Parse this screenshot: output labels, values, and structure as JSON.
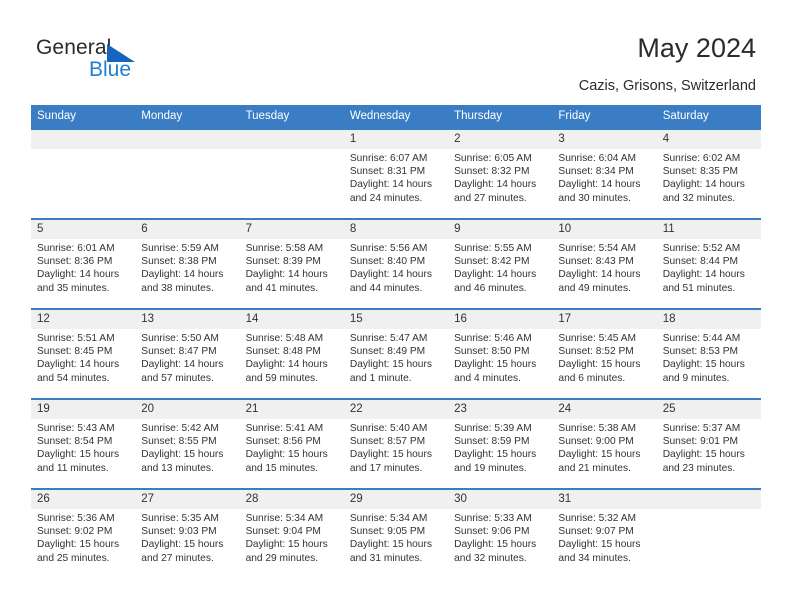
{
  "brand": {
    "name_top": "General",
    "name_bottom": "Blue",
    "triangle_color": "#1565c0",
    "blue_text_color": "#1b7fd4"
  },
  "header": {
    "title": "May 2024",
    "subtitle": "Cazis, Grisons, Switzerland"
  },
  "theme": {
    "header_blue": "#3b7dc4",
    "daynum_band": "#f0f0f0",
    "text": "#333333"
  },
  "calendar": {
    "weekday_headers": [
      "Sunday",
      "Monday",
      "Tuesday",
      "Wednesday",
      "Thursday",
      "Friday",
      "Saturday"
    ],
    "weeks": [
      [
        {
          "day": "",
          "sunrise": "",
          "sunset": "",
          "daylight_line1": "",
          "daylight_line2": ""
        },
        {
          "day": "",
          "sunrise": "",
          "sunset": "",
          "daylight_line1": "",
          "daylight_line2": ""
        },
        {
          "day": "",
          "sunrise": "",
          "sunset": "",
          "daylight_line1": "",
          "daylight_line2": ""
        },
        {
          "day": "1",
          "sunrise": "Sunrise: 6:07 AM",
          "sunset": "Sunset: 8:31 PM",
          "daylight_line1": "Daylight: 14 hours",
          "daylight_line2": "and 24 minutes."
        },
        {
          "day": "2",
          "sunrise": "Sunrise: 6:05 AM",
          "sunset": "Sunset: 8:32 PM",
          "daylight_line1": "Daylight: 14 hours",
          "daylight_line2": "and 27 minutes."
        },
        {
          "day": "3",
          "sunrise": "Sunrise: 6:04 AM",
          "sunset": "Sunset: 8:34 PM",
          "daylight_line1": "Daylight: 14 hours",
          "daylight_line2": "and 30 minutes."
        },
        {
          "day": "4",
          "sunrise": "Sunrise: 6:02 AM",
          "sunset": "Sunset: 8:35 PM",
          "daylight_line1": "Daylight: 14 hours",
          "daylight_line2": "and 32 minutes."
        }
      ],
      [
        {
          "day": "5",
          "sunrise": "Sunrise: 6:01 AM",
          "sunset": "Sunset: 8:36 PM",
          "daylight_line1": "Daylight: 14 hours",
          "daylight_line2": "and 35 minutes."
        },
        {
          "day": "6",
          "sunrise": "Sunrise: 5:59 AM",
          "sunset": "Sunset: 8:38 PM",
          "daylight_line1": "Daylight: 14 hours",
          "daylight_line2": "and 38 minutes."
        },
        {
          "day": "7",
          "sunrise": "Sunrise: 5:58 AM",
          "sunset": "Sunset: 8:39 PM",
          "daylight_line1": "Daylight: 14 hours",
          "daylight_line2": "and 41 minutes."
        },
        {
          "day": "8",
          "sunrise": "Sunrise: 5:56 AM",
          "sunset": "Sunset: 8:40 PM",
          "daylight_line1": "Daylight: 14 hours",
          "daylight_line2": "and 44 minutes."
        },
        {
          "day": "9",
          "sunrise": "Sunrise: 5:55 AM",
          "sunset": "Sunset: 8:42 PM",
          "daylight_line1": "Daylight: 14 hours",
          "daylight_line2": "and 46 minutes."
        },
        {
          "day": "10",
          "sunrise": "Sunrise: 5:54 AM",
          "sunset": "Sunset: 8:43 PM",
          "daylight_line1": "Daylight: 14 hours",
          "daylight_line2": "and 49 minutes."
        },
        {
          "day": "11",
          "sunrise": "Sunrise: 5:52 AM",
          "sunset": "Sunset: 8:44 PM",
          "daylight_line1": "Daylight: 14 hours",
          "daylight_line2": "and 51 minutes."
        }
      ],
      [
        {
          "day": "12",
          "sunrise": "Sunrise: 5:51 AM",
          "sunset": "Sunset: 8:45 PM",
          "daylight_line1": "Daylight: 14 hours",
          "daylight_line2": "and 54 minutes."
        },
        {
          "day": "13",
          "sunrise": "Sunrise: 5:50 AM",
          "sunset": "Sunset: 8:47 PM",
          "daylight_line1": "Daylight: 14 hours",
          "daylight_line2": "and 57 minutes."
        },
        {
          "day": "14",
          "sunrise": "Sunrise: 5:48 AM",
          "sunset": "Sunset: 8:48 PM",
          "daylight_line1": "Daylight: 14 hours",
          "daylight_line2": "and 59 minutes."
        },
        {
          "day": "15",
          "sunrise": "Sunrise: 5:47 AM",
          "sunset": "Sunset: 8:49 PM",
          "daylight_line1": "Daylight: 15 hours",
          "daylight_line2": "and 1 minute."
        },
        {
          "day": "16",
          "sunrise": "Sunrise: 5:46 AM",
          "sunset": "Sunset: 8:50 PM",
          "daylight_line1": "Daylight: 15 hours",
          "daylight_line2": "and 4 minutes."
        },
        {
          "day": "17",
          "sunrise": "Sunrise: 5:45 AM",
          "sunset": "Sunset: 8:52 PM",
          "daylight_line1": "Daylight: 15 hours",
          "daylight_line2": "and 6 minutes."
        },
        {
          "day": "18",
          "sunrise": "Sunrise: 5:44 AM",
          "sunset": "Sunset: 8:53 PM",
          "daylight_line1": "Daylight: 15 hours",
          "daylight_line2": "and 9 minutes."
        }
      ],
      [
        {
          "day": "19",
          "sunrise": "Sunrise: 5:43 AM",
          "sunset": "Sunset: 8:54 PM",
          "daylight_line1": "Daylight: 15 hours",
          "daylight_line2": "and 11 minutes."
        },
        {
          "day": "20",
          "sunrise": "Sunrise: 5:42 AM",
          "sunset": "Sunset: 8:55 PM",
          "daylight_line1": "Daylight: 15 hours",
          "daylight_line2": "and 13 minutes."
        },
        {
          "day": "21",
          "sunrise": "Sunrise: 5:41 AM",
          "sunset": "Sunset: 8:56 PM",
          "daylight_line1": "Daylight: 15 hours",
          "daylight_line2": "and 15 minutes."
        },
        {
          "day": "22",
          "sunrise": "Sunrise: 5:40 AM",
          "sunset": "Sunset: 8:57 PM",
          "daylight_line1": "Daylight: 15 hours",
          "daylight_line2": "and 17 minutes."
        },
        {
          "day": "23",
          "sunrise": "Sunrise: 5:39 AM",
          "sunset": "Sunset: 8:59 PM",
          "daylight_line1": "Daylight: 15 hours",
          "daylight_line2": "and 19 minutes."
        },
        {
          "day": "24",
          "sunrise": "Sunrise: 5:38 AM",
          "sunset": "Sunset: 9:00 PM",
          "daylight_line1": "Daylight: 15 hours",
          "daylight_line2": "and 21 minutes."
        },
        {
          "day": "25",
          "sunrise": "Sunrise: 5:37 AM",
          "sunset": "Sunset: 9:01 PM",
          "daylight_line1": "Daylight: 15 hours",
          "daylight_line2": "and 23 minutes."
        }
      ],
      [
        {
          "day": "26",
          "sunrise": "Sunrise: 5:36 AM",
          "sunset": "Sunset: 9:02 PM",
          "daylight_line1": "Daylight: 15 hours",
          "daylight_line2": "and 25 minutes."
        },
        {
          "day": "27",
          "sunrise": "Sunrise: 5:35 AM",
          "sunset": "Sunset: 9:03 PM",
          "daylight_line1": "Daylight: 15 hours",
          "daylight_line2": "and 27 minutes."
        },
        {
          "day": "28",
          "sunrise": "Sunrise: 5:34 AM",
          "sunset": "Sunset: 9:04 PM",
          "daylight_line1": "Daylight: 15 hours",
          "daylight_line2": "and 29 minutes."
        },
        {
          "day": "29",
          "sunrise": "Sunrise: 5:34 AM",
          "sunset": "Sunset: 9:05 PM",
          "daylight_line1": "Daylight: 15 hours",
          "daylight_line2": "and 31 minutes."
        },
        {
          "day": "30",
          "sunrise": "Sunrise: 5:33 AM",
          "sunset": "Sunset: 9:06 PM",
          "daylight_line1": "Daylight: 15 hours",
          "daylight_line2": "and 32 minutes."
        },
        {
          "day": "31",
          "sunrise": "Sunrise: 5:32 AM",
          "sunset": "Sunset: 9:07 PM",
          "daylight_line1": "Daylight: 15 hours",
          "daylight_line2": "and 34 minutes."
        },
        {
          "day": "",
          "sunrise": "",
          "sunset": "",
          "daylight_line1": "",
          "daylight_line2": ""
        }
      ]
    ]
  }
}
